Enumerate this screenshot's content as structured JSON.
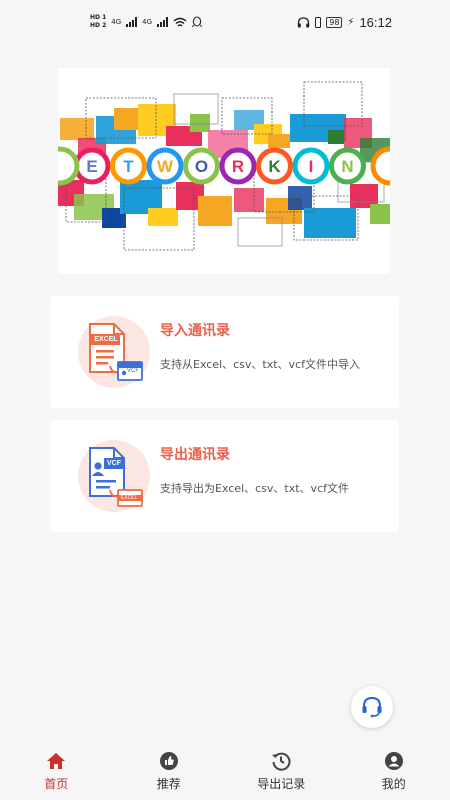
{
  "status_bar": {
    "hd_top": "HD 1",
    "hd_bottom": "HD 2",
    "network": "4G",
    "battery": "98",
    "time": "16:12"
  },
  "banner": {
    "letters": [
      "E",
      "T",
      "W",
      "O",
      "R",
      "K",
      "I",
      "N"
    ]
  },
  "cards": [
    {
      "title": "导入通讯录",
      "description": "支持从Excel、csv、txt、vcf文件中导入",
      "icon_badge": "EXCEL",
      "icon_sub": "VCF"
    },
    {
      "title": "导出通讯录",
      "description": "支持导出为Excel、csv、txt、vcf文件",
      "icon_badge": "VCF",
      "icon_sub": "EXCEL"
    }
  ],
  "tabs": [
    {
      "label": "首页",
      "icon": "home-icon",
      "active": true
    },
    {
      "label": "推荐",
      "icon": "thumbs-up-icon",
      "active": false
    },
    {
      "label": "导出记录",
      "icon": "history-icon",
      "active": false
    },
    {
      "label": "我的",
      "icon": "user-icon",
      "active": false
    }
  ],
  "colors": {
    "accent": "#e8614b",
    "tab_active": "#c8322a",
    "excel_orange": "#ee6b45",
    "vcf_blue": "#3d6fd6"
  }
}
